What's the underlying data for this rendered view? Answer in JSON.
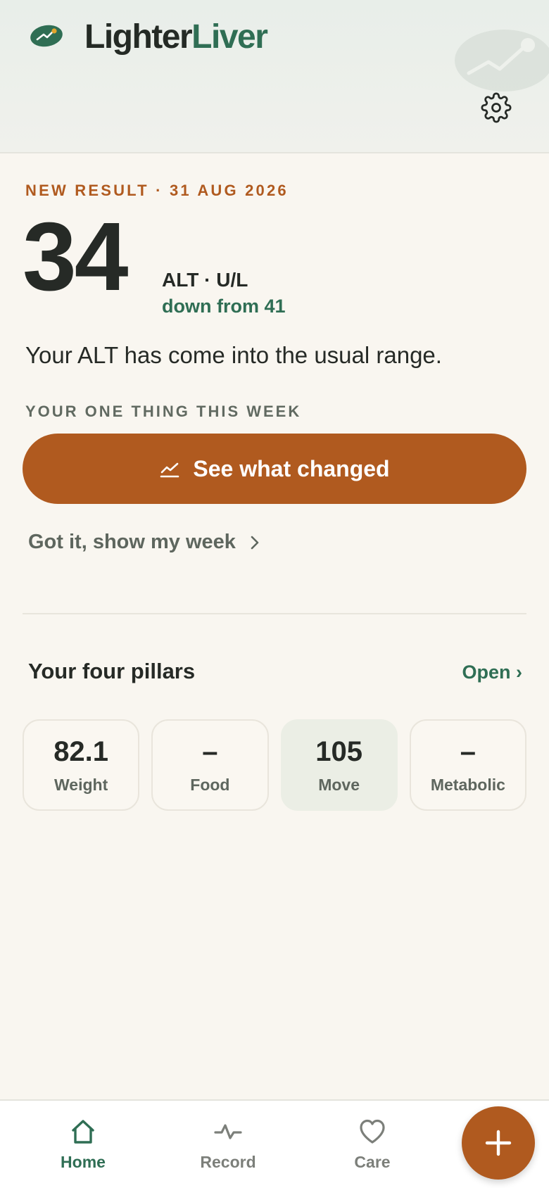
{
  "header": {
    "brand_part1": "Lighter",
    "brand_part2": "Liver",
    "logo_icon": "trend-leaf-icon",
    "settings_icon": "gear-icon"
  },
  "result": {
    "eyebrow": "NEW RESULT · 31 AUG 2026",
    "value": "34",
    "unit": "ALT · U/L",
    "delta": "down from 41",
    "message": "Your ALT has come into the usual range."
  },
  "focus": {
    "label": "YOUR ONE THING THIS WEEK",
    "cta_label": "See what changed",
    "cta_icon": "trend-line-icon",
    "secondary_label": "Got it, show my week",
    "secondary_icon": "chevron-right-icon"
  },
  "pillars": {
    "title": "Your four pillars",
    "open_label": "Open ›",
    "items": [
      {
        "value": "82.1",
        "label": "Weight",
        "active": false
      },
      {
        "value": "–",
        "label": "Food",
        "active": false
      },
      {
        "value": "105",
        "label": "Move",
        "active": true
      },
      {
        "value": "–",
        "label": "Metabolic",
        "active": false
      }
    ]
  },
  "nav": {
    "items": [
      {
        "label": "Home",
        "icon": "home-icon",
        "active": true
      },
      {
        "label": "Record",
        "icon": "pulse-icon",
        "active": false
      },
      {
        "label": "Care",
        "icon": "heart-icon",
        "active": false
      }
    ],
    "fab_icon": "plus-icon"
  },
  "colors": {
    "accent": "#b05a1f",
    "brand_green": "#2f6e54",
    "background": "#f9f6f0",
    "text": "#262a26"
  }
}
